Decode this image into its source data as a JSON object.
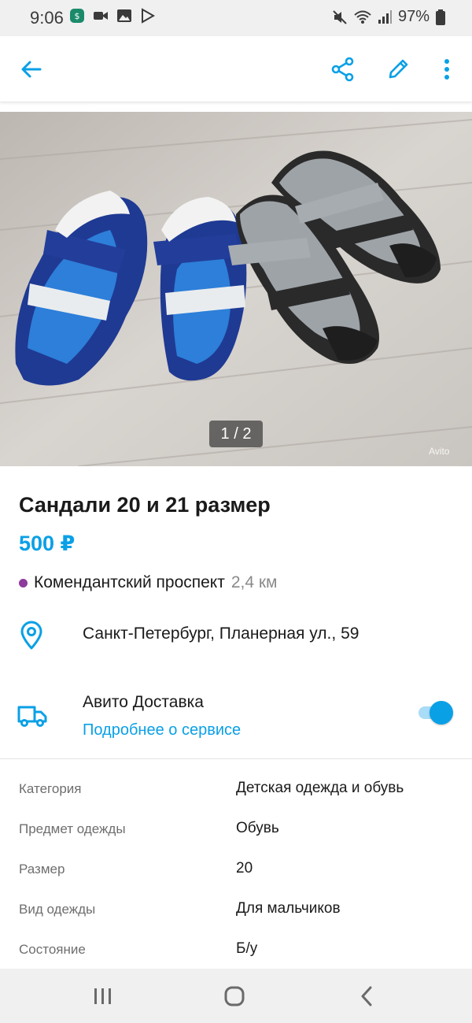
{
  "status_bar": {
    "time": "9:06",
    "battery": "97%"
  },
  "app_bar": {
    "back_icon": "arrow-left-icon",
    "share_icon": "share-icon",
    "edit_icon": "pencil-icon",
    "more_icon": "more-vertical-icon"
  },
  "photo": {
    "counter": "1 / 2",
    "watermark": "Avito"
  },
  "listing": {
    "title": "Сандали 20 и 21 размер",
    "price": "500 ₽",
    "metro": {
      "name": "Комендантский проспект",
      "distance": "2,4 км",
      "color": "#8e3a9d"
    },
    "address": "Санкт-Петербург, Планерная ул., 59"
  },
  "delivery": {
    "title": "Авито Доставка",
    "link": "Подробнее о сервисе",
    "enabled": true
  },
  "params": [
    {
      "key": "Категория",
      "value": "Детская одежда и обувь"
    },
    {
      "key": "Предмет одежды",
      "value": "Обувь"
    },
    {
      "key": "Размер",
      "value": "20"
    },
    {
      "key": "Вид одежды",
      "value": "Для мальчиков"
    },
    {
      "key": "Состояние",
      "value": "Б/у"
    }
  ],
  "colors": {
    "accent": "#0aa0e6",
    "text": "#1a1a1a",
    "muted": "#6e6e6e"
  }
}
